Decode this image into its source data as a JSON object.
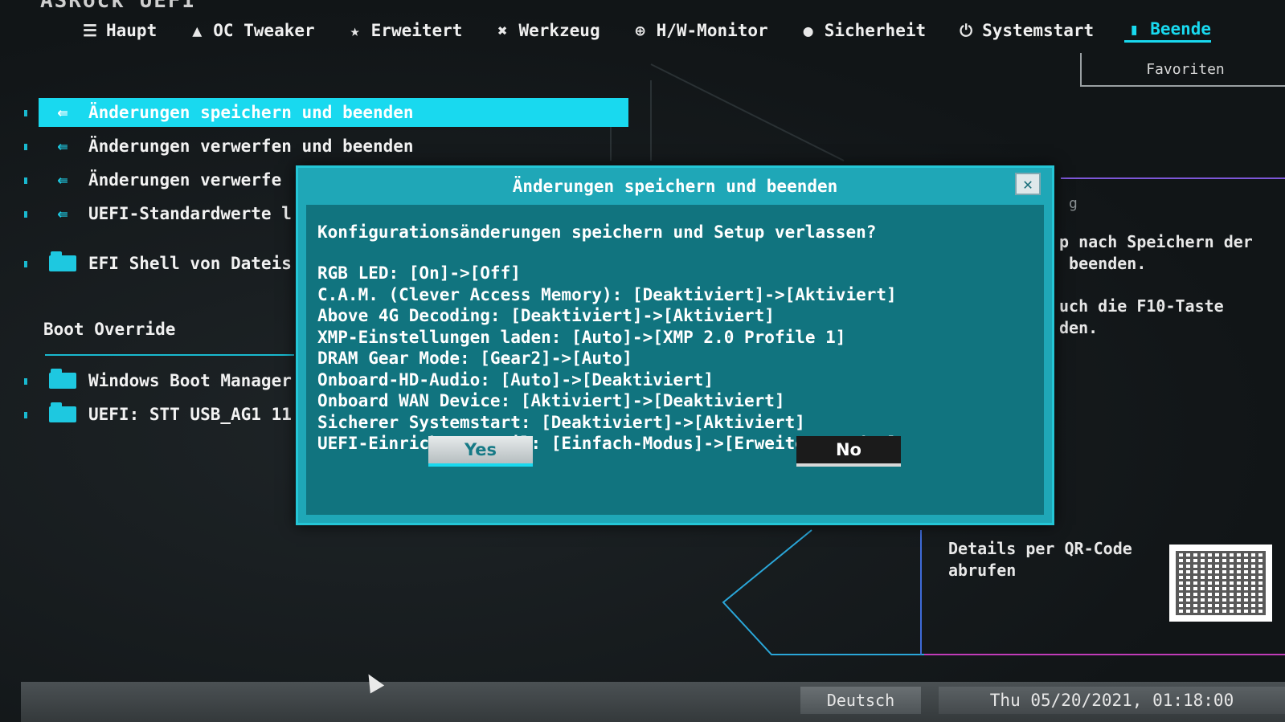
{
  "brand": "ASRock UEFI",
  "nav": [
    {
      "label": "Haupt",
      "icon": "list-icon"
    },
    {
      "label": "OC Tweaker",
      "icon": "rocket-icon"
    },
    {
      "label": "Erweitert",
      "icon": "star-icon"
    },
    {
      "label": "Werkzeug",
      "icon": "tools-icon"
    },
    {
      "label": "H/W-Monitor",
      "icon": "monitor-icon"
    },
    {
      "label": "Sicherheit",
      "icon": "shield-icon"
    },
    {
      "label": "Systemstart",
      "icon": "power-icon"
    },
    {
      "label": "Beende",
      "icon": "exit-icon"
    }
  ],
  "favorites_label": "Favoriten",
  "menu": [
    {
      "label": "Änderungen speichern und beenden"
    },
    {
      "label": "Änderungen verwerfen und beenden"
    },
    {
      "label": "Änderungen verwerfe"
    },
    {
      "label": "UEFI-Standardwerte l"
    },
    {
      "label": "EFI Shell von Dateis"
    }
  ],
  "boot_override_title": "Boot Override",
  "boot_items": [
    {
      "label": "Windows Boot Manager"
    },
    {
      "label": "UEFI: STT USB_AG1 11"
    }
  ],
  "help": {
    "hint": "g",
    "line1": "p nach Speichern der\n beenden.",
    "line2": "uch die F10-Taste\nden."
  },
  "qr_label": "Details per QR-Code\nabrufen",
  "dialog": {
    "title": "Änderungen speichern und beenden",
    "question": "Konfigurationsänderungen speichern und Setup verlassen?",
    "changes": [
      "RGB LED: [On]->[Off]",
      "C.A.M. (Clever Access Memory): [Deaktiviert]->[Aktiviert]",
      "Above 4G Decoding: [Deaktiviert]->[Aktiviert]",
      "XMP-Einstellungen laden: [Auto]->[XMP 2.0 Profile 1]",
      "DRAM Gear Mode: [Gear2]->[Auto]",
      "Onboard-HD-Audio: [Auto]->[Deaktiviert]",
      "Onboard WAN Device: [Aktiviert]->[Deaktiviert]",
      "Sicherer Systemstart: [Deaktiviert]->[Aktiviert]",
      "UEFI-Einrichtungsstil: [Einfach-Modus]->[Erweitert-Modus]"
    ],
    "yes_label": "Yes",
    "no_label": "No",
    "close_symbol": "✕"
  },
  "language": "Deutsch",
  "datetime": "Thu 05/20/2021, 01:18:00",
  "colors": {
    "accent": "#19d9ef",
    "dialog": "#1fa7b7",
    "dialog_body": "#11747f"
  }
}
